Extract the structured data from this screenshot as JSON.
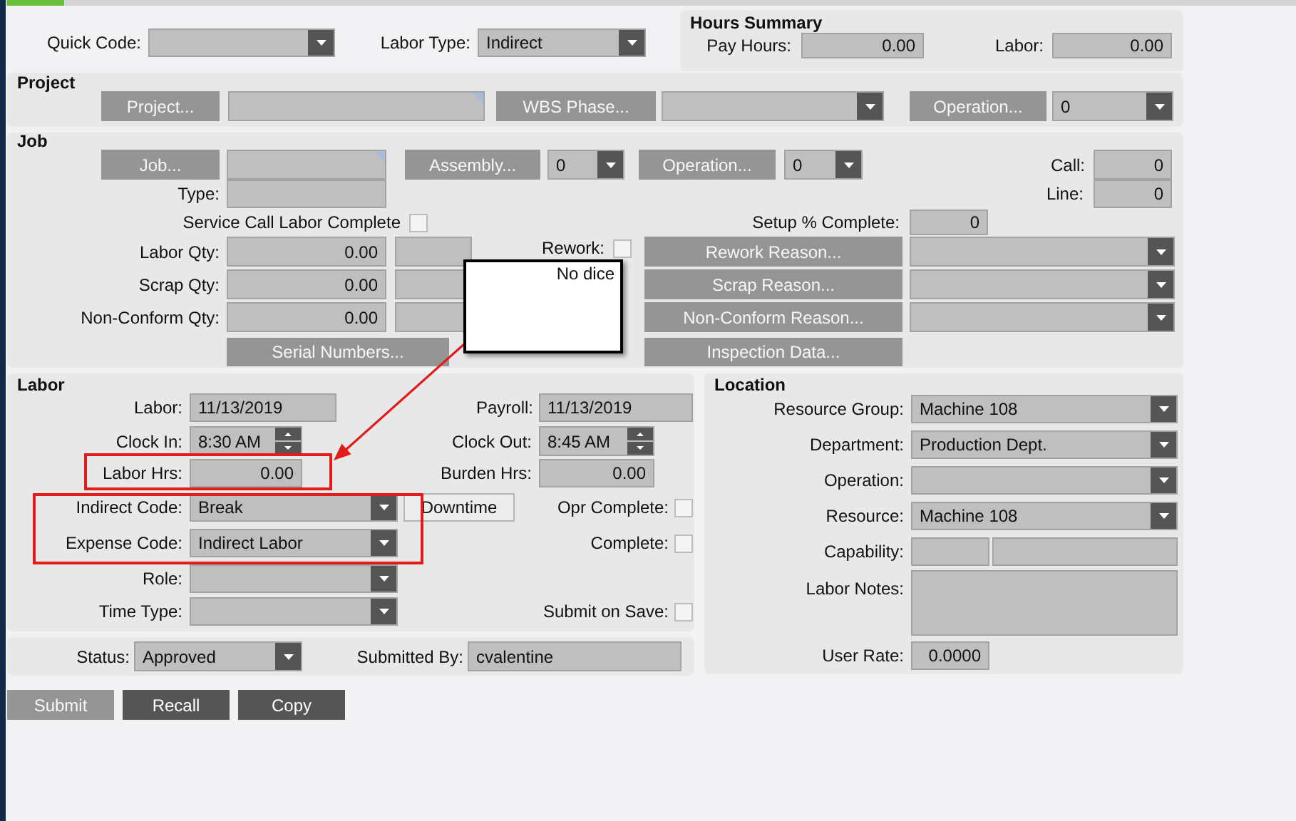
{
  "quick_code": {
    "label": "Quick Code:"
  },
  "labor_type": {
    "label": "Labor Type:",
    "value": "Indirect"
  },
  "hours_summary": {
    "title": "Hours Summary",
    "pay_hours": {
      "label": "Pay Hours:",
      "value": "0.00"
    },
    "labor": {
      "label": "Labor:",
      "value": "0.00"
    }
  },
  "project": {
    "title": "Project",
    "project_button": {
      "label": "Project...",
      "disabled": true
    },
    "wbs_phase_button": {
      "label": "WBS Phase...",
      "disabled": true
    },
    "operation_button": {
      "label": "Operation...",
      "disabled": true
    },
    "operation": {
      "value": "0"
    }
  },
  "job": {
    "title": "Job",
    "job_button": {
      "label": "Job...",
      "disabled": true
    },
    "assembly_button": {
      "label": "Assembly...",
      "disabled": true
    },
    "assembly": {
      "value": "0"
    },
    "operation_button": {
      "label": "Operation...",
      "disabled": true
    },
    "operation": {
      "value": "0"
    },
    "call": {
      "label": "Call:",
      "value": "0"
    },
    "type": {
      "label": "Type:"
    },
    "line": {
      "label": "Line:",
      "value": "0"
    },
    "service_call_labor_complete": {
      "label": "Service Call Labor Complete",
      "checked": false
    },
    "setup_complete": {
      "label": "Setup % Complete:",
      "value": "0"
    },
    "labor_qty": {
      "label": "Labor Qty:",
      "value": "0.00"
    },
    "scrap_qty": {
      "label": "Scrap Qty:",
      "value": "0.00"
    },
    "non_conform_qty": {
      "label": "Non-Conform Qty:",
      "value": "0.00"
    },
    "rework": {
      "label": "Rework:",
      "checked": false
    },
    "rework_reason_button": {
      "label": "Rework Reason...",
      "disabled": true
    },
    "scrap_reason_button": {
      "label": "Scrap Reason...",
      "disabled": true
    },
    "non_conform_reason_button": {
      "label": "Non-Conform Reason...",
      "disabled": true
    },
    "serial_numbers_button": {
      "label": "Serial Numbers...",
      "disabled": true
    },
    "inspection_data_button": {
      "label": "Inspection Data...",
      "disabled": true
    }
  },
  "labor": {
    "title": "Labor",
    "labor_date": {
      "label": "Labor:",
      "value": "11/13/2019"
    },
    "payroll_date": {
      "label": "Payroll:",
      "value": "11/13/2019"
    },
    "clock_in": {
      "label": "Clock In:",
      "value": "8:30 AM"
    },
    "clock_out": {
      "label": "Clock Out:",
      "value": "8:45 AM"
    },
    "labor_hrs": {
      "label": "Labor Hrs:",
      "value": "0.00"
    },
    "burden_hrs": {
      "label": "Burden Hrs:",
      "value": "0.00"
    },
    "indirect_code": {
      "label": "Indirect Code:",
      "value": "Break"
    },
    "downtime_button": {
      "label": "Downtime",
      "disabled": false
    },
    "opr_complete": {
      "label": "Opr Complete:",
      "checked": false
    },
    "expense_code": {
      "label": "Expense Code:",
      "value": "Indirect Labor"
    },
    "complete": {
      "label": "Complete:",
      "checked": false
    },
    "role": {
      "label": "Role:"
    },
    "time_type": {
      "label": "Time Type:"
    },
    "submit_on_save": {
      "label": "Submit on Save:",
      "checked": false
    }
  },
  "status": {
    "label": "Status:",
    "value": "Approved"
  },
  "submitted_by": {
    "label": "Submitted By:",
    "value": "cvalentine"
  },
  "location": {
    "title": "Location",
    "resource_group": {
      "label": "Resource Group:",
      "value": "Machine 108"
    },
    "department": {
      "label": "Department:",
      "value": "Production Dept."
    },
    "operation": {
      "label": "Operation:"
    },
    "resource": {
      "label": "Resource:",
      "value": "Machine 108"
    },
    "capability": {
      "label": "Capability:"
    },
    "labor_notes": {
      "label": "Labor Notes:"
    },
    "user_rate": {
      "label": "User Rate:",
      "value": "0.0000"
    }
  },
  "buttons": [
    {
      "label": "Submit",
      "disabled": true
    },
    {
      "label": "Recall",
      "disabled": false
    },
    {
      "label": "Copy",
      "disabled": false
    }
  ],
  "tooltip": {
    "text": "No dice"
  }
}
